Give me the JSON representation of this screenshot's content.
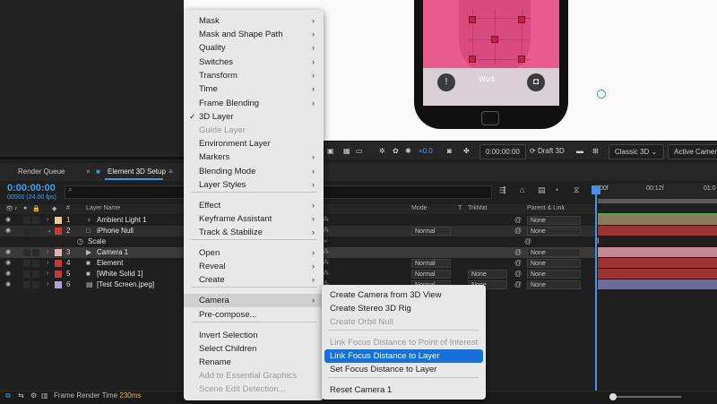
{
  "menu": {
    "items": [
      {
        "label": "Mask",
        "submenu": true
      },
      {
        "label": "Mask and Shape Path",
        "submenu": true
      },
      {
        "label": "Quality",
        "submenu": true
      },
      {
        "label": "Switches",
        "submenu": true
      },
      {
        "label": "Transform",
        "submenu": true
      },
      {
        "label": "Time",
        "submenu": true
      },
      {
        "label": "Frame Blending",
        "submenu": true
      },
      {
        "label": "3D Layer",
        "checked": true
      },
      {
        "label": "Guide Layer",
        "disabled": true
      },
      {
        "label": "Environment Layer"
      },
      {
        "label": "Markers",
        "submenu": true
      },
      {
        "label": "Blending Mode",
        "submenu": true
      },
      {
        "label": "Layer Styles",
        "submenu": true
      },
      {
        "label": "Effect",
        "submenu": true
      },
      {
        "label": "Keyframe Assistant",
        "submenu": true
      },
      {
        "label": "Track & Stabilize",
        "submenu": true
      },
      {
        "label": "Open",
        "submenu": true
      },
      {
        "label": "Reveal",
        "submenu": true
      },
      {
        "label": "Create",
        "submenu": true
      },
      {
        "label": "Camera",
        "submenu": true,
        "highlighted": true
      },
      {
        "label": "Pre-compose..."
      },
      {
        "label": "Invert Selection"
      },
      {
        "label": "Select Children"
      },
      {
        "label": "Rename"
      },
      {
        "label": "Add to Essential Graphics",
        "disabled": true
      },
      {
        "label": "Scene Edit Detection...",
        "disabled": true
      }
    ],
    "check_mark": "✓",
    "arrow": "›"
  },
  "submenu": {
    "items": [
      {
        "label": "Create Camera from 3D View"
      },
      {
        "label": "Create Stereo 3D Rig"
      },
      {
        "label": "Create Orbit Null",
        "disabled": true
      },
      {
        "label": "Link Focus Distance to Point of Interest",
        "disabled": true
      },
      {
        "label": "Link Focus Distance to Layer",
        "selected": true
      },
      {
        "label": "Set Focus Distance to Layer"
      },
      {
        "label": "Reset Camera 1"
      }
    ]
  },
  "tabs": {
    "render_queue": "Render Queue",
    "comp": "Element 3D Setup",
    "close": "×",
    "menu": "≡"
  },
  "timeline": {
    "timecode": "0:00:00:00",
    "fps": "00000 (24.00 fps)",
    "search_icon": "⌕",
    "headers": {
      "num": "#",
      "layer_name": "Layer Name",
      "mode": "Mode",
      "t": "T",
      "trkmat": "TrkMat",
      "parent": "Parent & Link"
    },
    "ruler": {
      "t0": "00f",
      "t1": "00:12f",
      "t2": "01:0"
    }
  },
  "layers": [
    {
      "num": "1",
      "name": "Ambient Light 1",
      "icon": "💡",
      "label_color": "#e5c89a",
      "mode": "",
      "trkmat": "",
      "parent": "None"
    },
    {
      "num": "2",
      "name": "iPhone Null",
      "icon": "",
      "label_color": "#c23a3a",
      "mode": "Normal",
      "trkmat": "",
      "parent": "None",
      "expanded": true
    },
    {
      "num": "",
      "name": "Scale",
      "sub": true
    },
    {
      "num": "3",
      "name": "Camera 1",
      "icon": "🎥",
      "label_color": "#e8b0b8",
      "mode": "",
      "trkmat": "",
      "parent": "None",
      "selected": true
    },
    {
      "num": "4",
      "name": "Element",
      "icon": "",
      "label_color": "#c23a3a",
      "mode": "Normal",
      "trkmat": "",
      "parent": "None"
    },
    {
      "num": "5",
      "name": "[White Solid 1]",
      "icon": "",
      "label_color": "#c23a3a",
      "mode": "Normal",
      "trkmat": "None",
      "parent": "None"
    },
    {
      "num": "6",
      "name": "[Test Screen.jpeg]",
      "icon": "",
      "label_color": "#a8a8d8",
      "mode": "Normal",
      "trkmat": "None",
      "parent": "None"
    }
  ],
  "viewer": {
    "plus_value": "+0.0",
    "time": "0:00:00:00",
    "draft": "Draft 3D",
    "renderer": "Classic 3D",
    "camera": "Active Camera"
  },
  "phone": {
    "work": "Work"
  },
  "status": {
    "label": "Frame Render Time",
    "ms": "230ms"
  },
  "colors": {
    "menu_bg": "#e8e8e8",
    "selected": "#1a6fd6",
    "accent_blue": "#4a90e2"
  }
}
